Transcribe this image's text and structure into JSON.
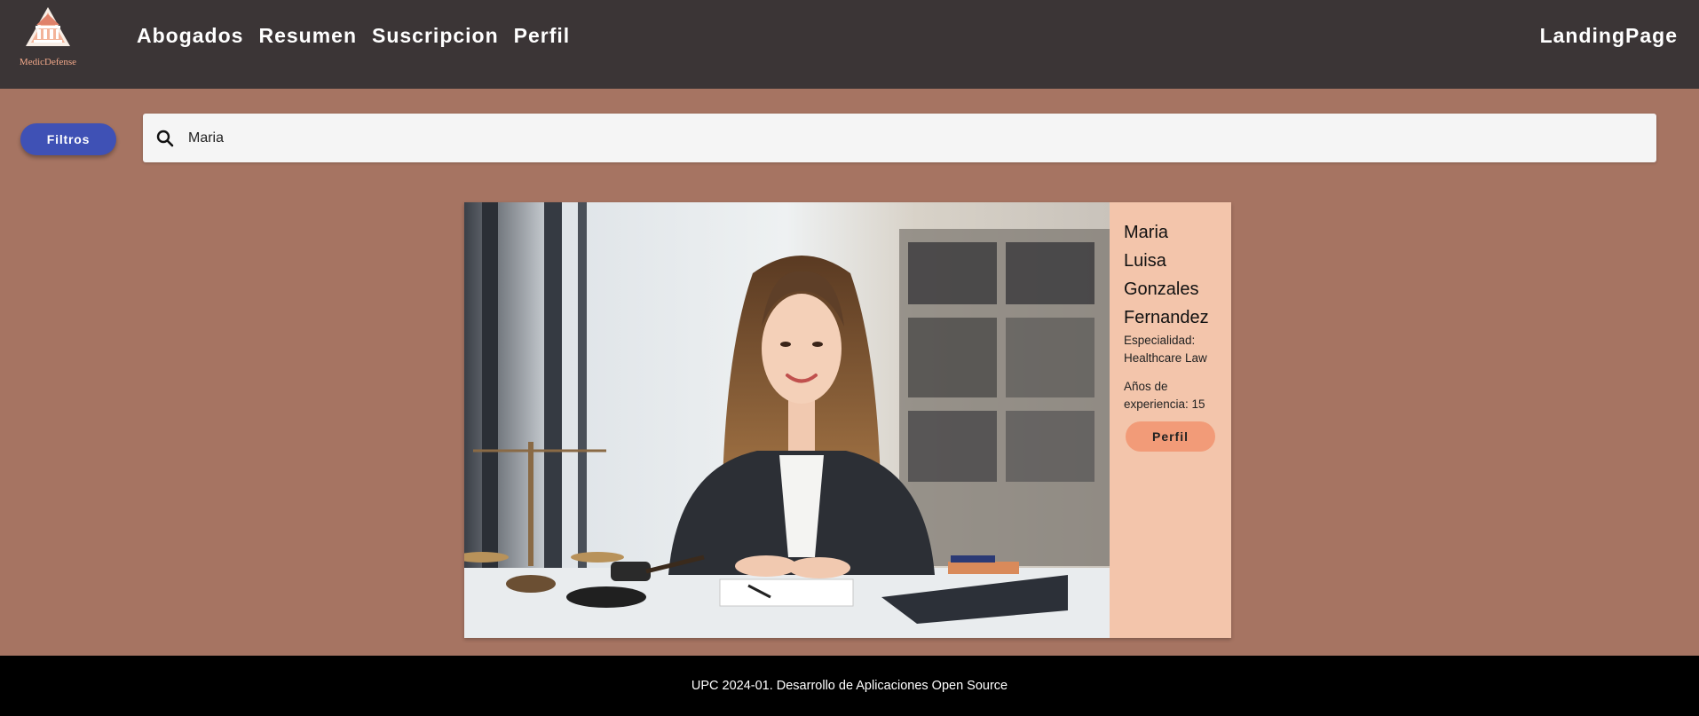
{
  "header": {
    "logo_text": "MedicDefense",
    "nav": [
      {
        "label": "Abogados"
      },
      {
        "label": "Resumen"
      },
      {
        "label": "Suscripcion"
      },
      {
        "label": "Perfil"
      }
    ],
    "right_link": "LandingPage"
  },
  "filters": {
    "button_label": "Filtros"
  },
  "search": {
    "icon": "search-icon",
    "value": "Maria"
  },
  "results": [
    {
      "name_lines": [
        "Maria",
        "Luisa",
        "Gonzales",
        "Fernandez"
      ],
      "specialty": "Especialidad: Healthcare Law",
      "experience": "Años de experiencia: 15",
      "button_label": "Perfil"
    }
  ],
  "footer": {
    "text": "UPC 2024-01. Desarrollo de Aplicaciones Open Source"
  },
  "colors": {
    "page_bg": "#a67462",
    "header_bg": "#3b3536",
    "filter_button": "#3f51b5",
    "card_info_bg": "#f3c5ab",
    "profile_button": "#f29b78",
    "footer_bg": "#000000"
  }
}
